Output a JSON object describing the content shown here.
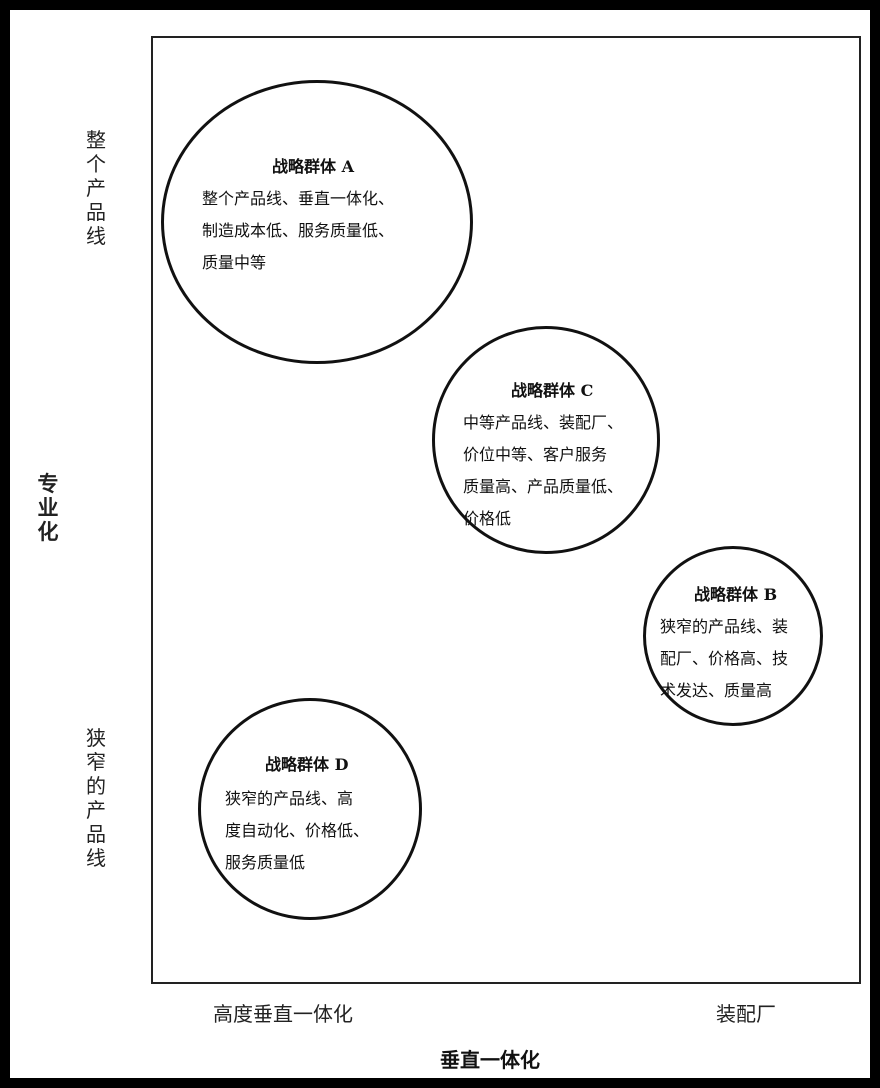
{
  "axes": {
    "y_label": "专业化",
    "y_top_tick": "整个产品线",
    "y_bottom_tick": "狭窄的产品线",
    "x_label": "垂直一体化",
    "x_left_tick": "高度垂直一体化",
    "x_right_tick": "装配厂"
  },
  "groups": {
    "a": {
      "title": "战略群体 A",
      "lines": [
        "整个产品线、垂直一体化、",
        "制造成本低、服务质量低、",
        "质量中等"
      ]
    },
    "c": {
      "title": "战略群体 C",
      "lines": [
        "中等产品线、装配厂、",
        "价位中等、客户服务",
        "质量高、产品质量低、",
        "价格低"
      ]
    },
    "b": {
      "title": "战略群体 B",
      "lines": [
        "狭窄的产品线、装",
        "配厂、价格高、技",
        "术发达、质量高"
      ]
    },
    "d": {
      "title": "战略群体 D",
      "lines": [
        "狭窄的产品线、高",
        "度自动化、价格低、",
        "服务质量低"
      ]
    }
  }
}
